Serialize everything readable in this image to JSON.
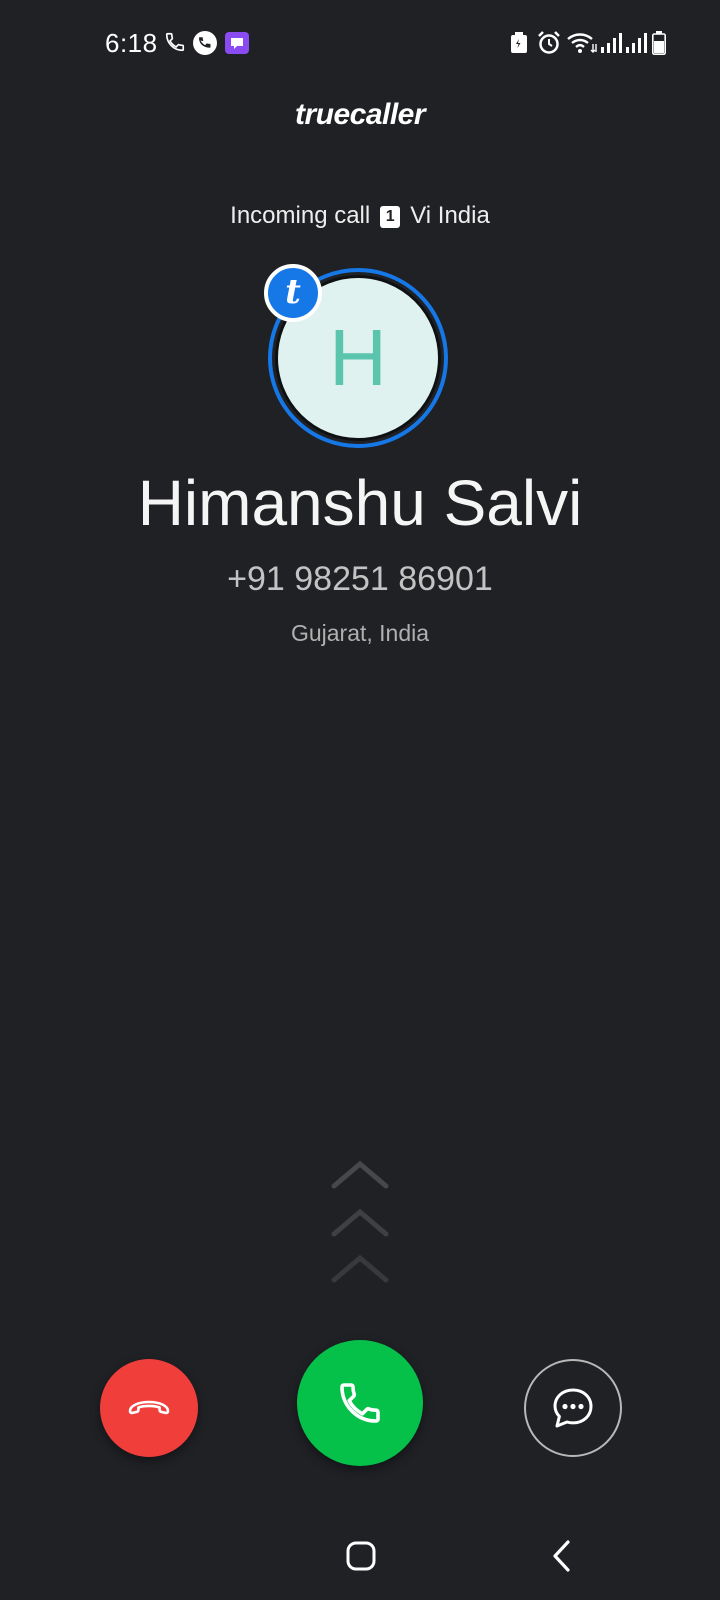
{
  "status_bar": {
    "time": "6:18",
    "left_icons": [
      "phone-icon",
      "whatsapp-call-icon",
      "message-app-icon"
    ],
    "right_icons": [
      "battery-saver-icon",
      "alarm-icon",
      "wifi-icon",
      "signal-sim1-icon",
      "signal-sim2-icon",
      "battery-icon"
    ]
  },
  "brand": "truecaller",
  "call": {
    "status": "Incoming call",
    "sim_slot": "1",
    "carrier": "Vi India",
    "avatar_letter": "H",
    "badge_letter": "t",
    "caller_name": "Himanshu Salvi",
    "caller_number": "+91 98251 86901",
    "caller_location": "Gujarat, India"
  },
  "actions": {
    "decline_icon": "phone-hangup-icon",
    "accept_icon": "phone-answer-icon",
    "message_icon": "chat-bubble-icon"
  },
  "colors": {
    "background": "#202125",
    "accent": "#1678e6",
    "decline": "#f03e3b",
    "accept": "#05c14a",
    "avatar_bg": "#dff2ef",
    "avatar_letter": "#5bc4ad"
  },
  "nav": {
    "home_icon": "home-icon",
    "back_icon": "back-icon"
  }
}
